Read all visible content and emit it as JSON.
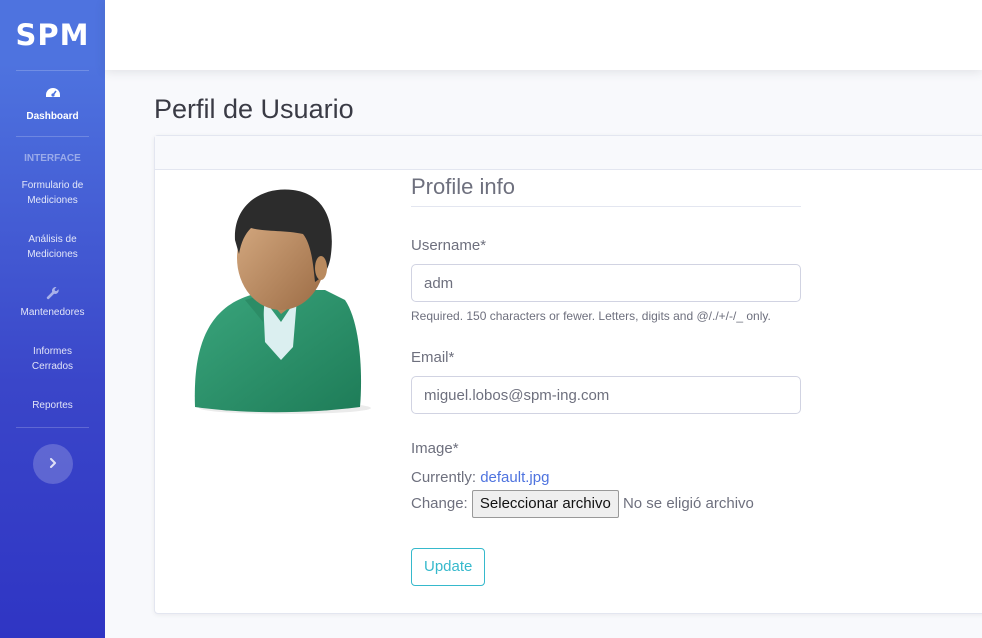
{
  "sidebar": {
    "brand": "SPM",
    "dashboard_label": "Dashboard",
    "heading": "INTERFACE",
    "items": [
      {
        "label_line1": "Formulario de",
        "label_line2": "Mediciones"
      },
      {
        "label_line1": "Análisis de",
        "label_line2": "Mediciones"
      },
      {
        "label_line1": "Mantenedores",
        "label_line2": ""
      },
      {
        "label_line1": "Informes",
        "label_line2": "Cerrados"
      },
      {
        "label_line1": "Reportes",
        "label_line2": ""
      }
    ],
    "icons": {
      "dashboard": "tachometer-icon",
      "mantenedores": "wrench-icon",
      "toggle": "chevron-right-icon"
    }
  },
  "page": {
    "title": "Perfil de Usuario"
  },
  "form": {
    "title": "Profile info",
    "username_label": "Username*",
    "username_value": "adm",
    "username_help": "Required. 150 characters or fewer. Letters, digits and @/./+/-/_ only.",
    "email_label": "Email*",
    "email_value": "miguel.lobos@spm-ing.com",
    "image_label": "Image*",
    "currently_label": "Currently:",
    "currently_file": "default.jpg",
    "change_label": "Change:",
    "file_button": "Seleccionar archivo",
    "file_status": "No se eligió archivo",
    "update_button": "Update"
  },
  "colors": {
    "sidebar_top": "#4e73df",
    "sidebar_bottom": "#2f35c4",
    "accent_info": "#36b9cc",
    "link": "#4e73df"
  }
}
